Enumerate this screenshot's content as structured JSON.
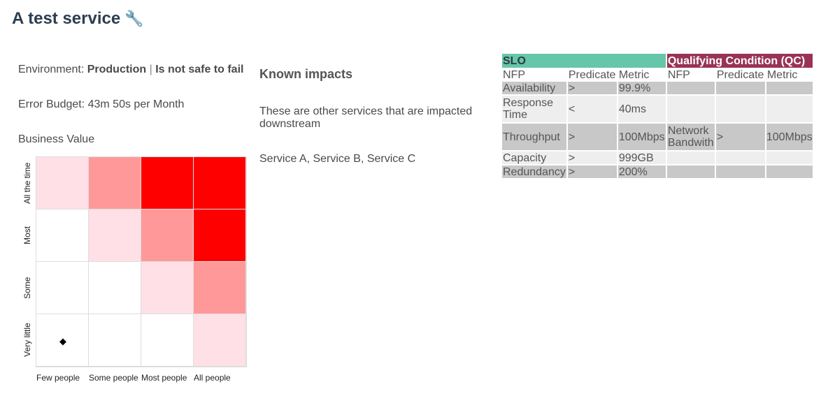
{
  "service": {
    "title": "A test service",
    "icon": "wrench-icon"
  },
  "environment": {
    "label": "Environment:",
    "value": "Production",
    "separator": "|",
    "safety": "Is not safe to fail"
  },
  "error_budget": "Error Budget: 43m 50s per Month",
  "business_value": {
    "title": "Business Value",
    "y_labels": [
      "All the time",
      "Most",
      "Some",
      "Very little"
    ],
    "x_labels": [
      "Few people",
      "Some people",
      "Most people",
      "All people"
    ],
    "cells": [
      [
        "#ffe0e6",
        "#ff9999",
        "#ff0000",
        "#ff0000"
      ],
      [
        "#ffffff",
        "#ffe0e6",
        "#ff9999",
        "#ff0000"
      ],
      [
        "#ffffff",
        "#ffffff",
        "#ffe0e6",
        "#ff9999"
      ],
      [
        "#ffffff",
        "#ffffff",
        "#ffffff",
        "#ffe0e6"
      ]
    ],
    "marker": {
      "row": "Very little",
      "col": "Few people",
      "glyph": "◆"
    }
  },
  "known_impacts": {
    "title": "Known impacts",
    "description": "These are other services that are impacted downstream",
    "services": "Service A, Service B, Service C"
  },
  "slo_table": {
    "slo_header": "SLO",
    "qc_header": "Qualifying Condition (QC)",
    "columns": [
      "NFP",
      "Predicate",
      "Metric",
      "NFP",
      "Predicate",
      "Metric"
    ],
    "rows": [
      {
        "nfp": "Availability",
        "predicate": ">",
        "metric": "99.9%",
        "qc_nfp": "",
        "qc_predicate": "",
        "qc_metric": ""
      },
      {
        "nfp": "Response Time",
        "predicate": "<",
        "metric": "40ms",
        "qc_nfp": "",
        "qc_predicate": "",
        "qc_metric": ""
      },
      {
        "nfp": "Throughput",
        "predicate": ">",
        "metric": "100Mbps",
        "qc_nfp": "Network Bandwith",
        "qc_predicate": ">",
        "qc_metric": "100Mbps"
      },
      {
        "nfp": "Capacity",
        "predicate": ">",
        "metric": "999GB",
        "qc_nfp": "",
        "qc_predicate": "",
        "qc_metric": ""
      },
      {
        "nfp": "Redundancy",
        "predicate": ">",
        "metric": "200%",
        "qc_nfp": "",
        "qc_predicate": "",
        "qc_metric": ""
      }
    ],
    "colors": {
      "slo": "#66c6a9",
      "qc": "#993355",
      "row_dark": "#c8c8c8",
      "row_light": "#eeeeee"
    }
  }
}
